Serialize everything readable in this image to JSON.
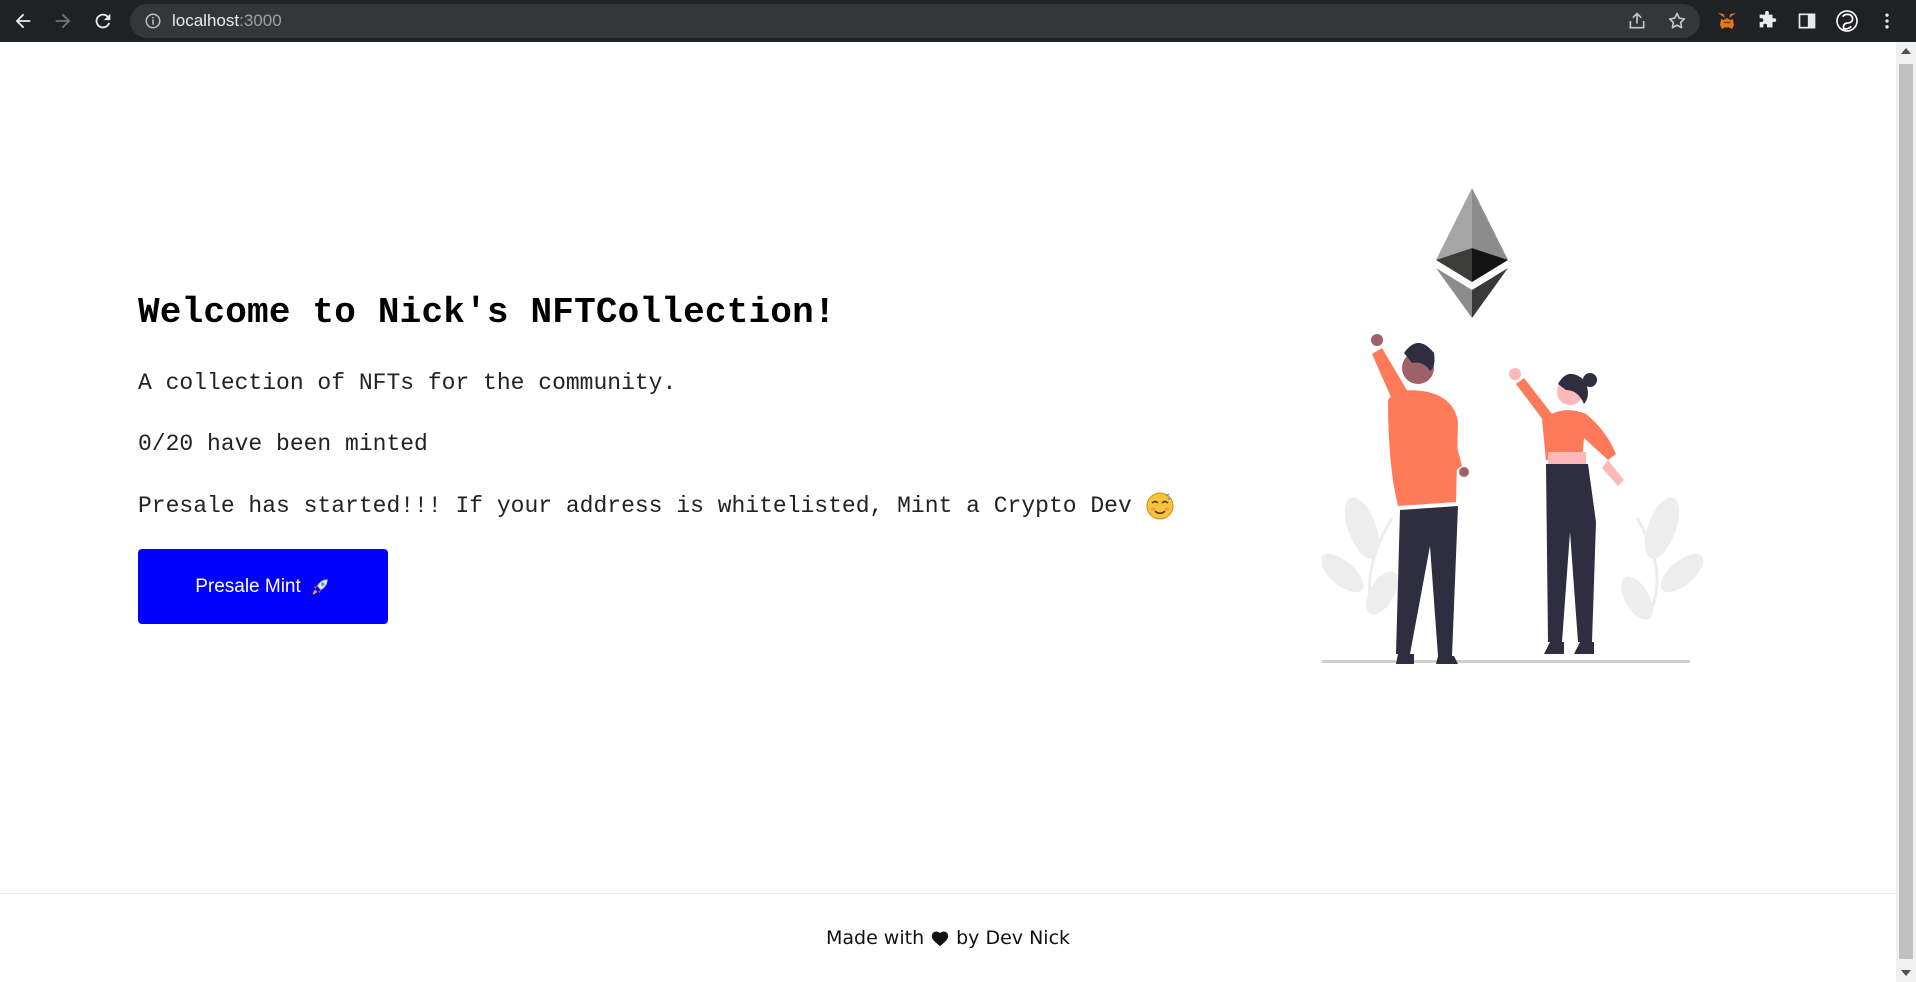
{
  "browser": {
    "url_host": "localhost",
    "url_port": ":3000"
  },
  "hero": {
    "title": "Welcome to Nick's NFTCollection!",
    "description": "A collection of NFTs for the community.",
    "minted_status": "0/20 have been minted",
    "presale_message": "Presale has started!!! If your address is whitelisted, Mint a Crypto Dev",
    "mint_button_label": "Presale Mint"
  },
  "footer": {
    "made_with": "Made with",
    "by": "by Dev Nick"
  },
  "colors": {
    "mint_button": "#0000ff",
    "illustration_accent": "#ff7a59",
    "illustration_dark": "#2f2e41"
  },
  "icons": [
    "back-icon",
    "forward-icon",
    "reload-icon",
    "info-icon",
    "share-icon",
    "star-icon",
    "metamask-icon",
    "extensions-icon",
    "sidepanel-icon",
    "profile-icon",
    "menu-icon",
    "rocket-icon",
    "face-emoji-icon",
    "heart-icon",
    "ethereum-logo"
  ]
}
